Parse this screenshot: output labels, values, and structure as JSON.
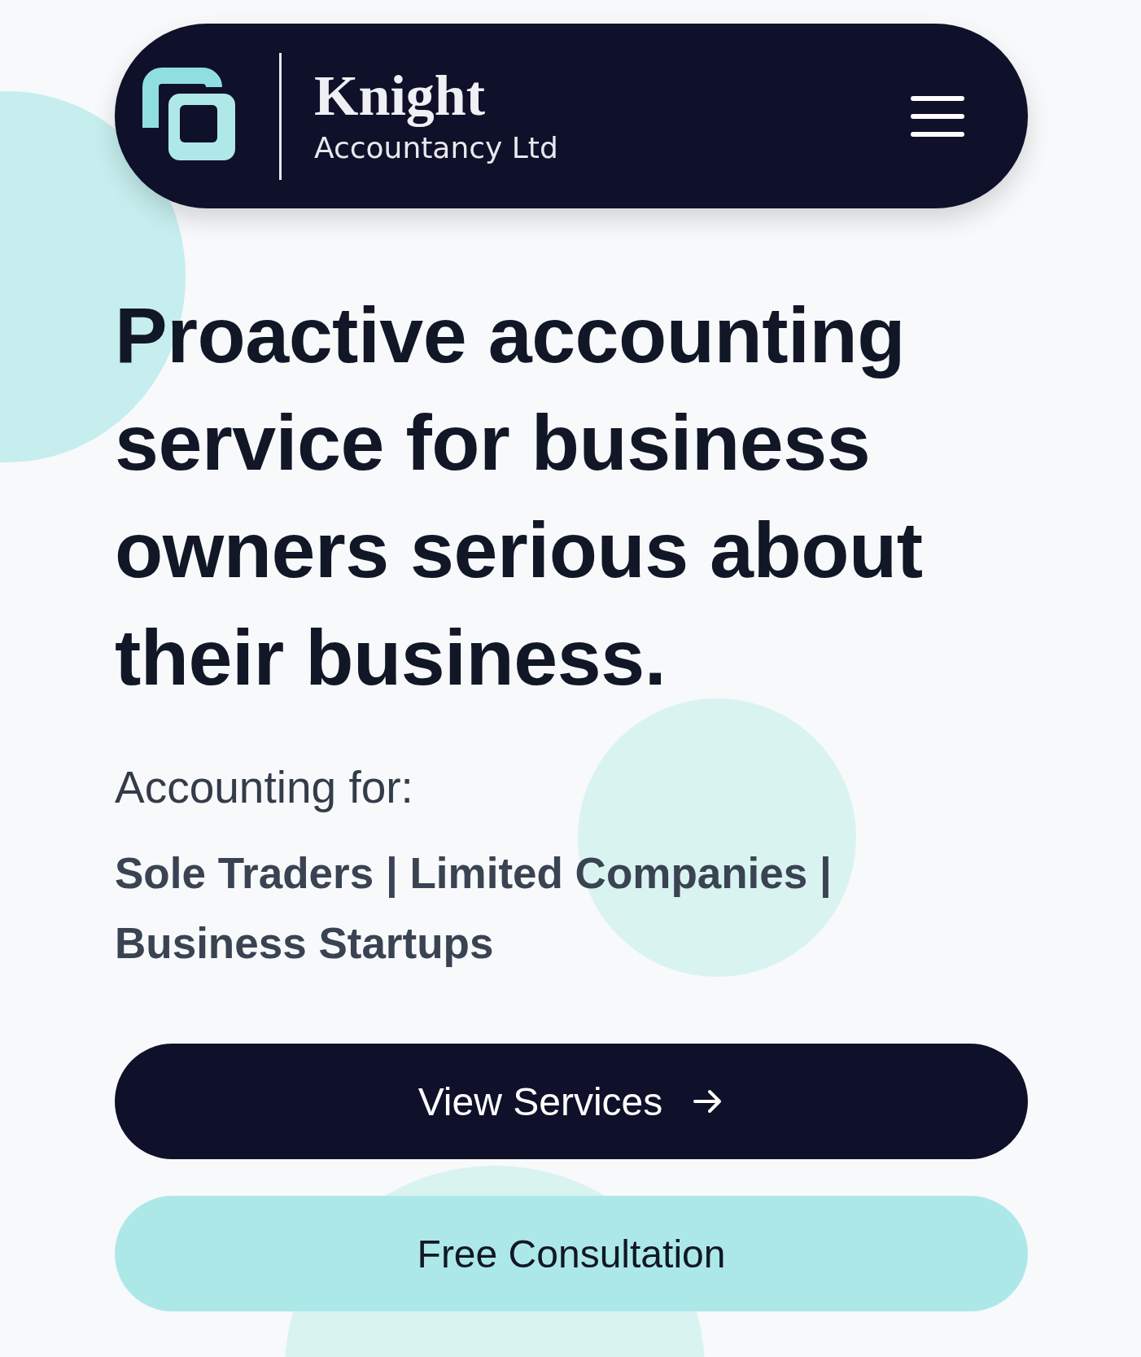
{
  "header": {
    "brand_name": "Knight",
    "brand_subtitle": "Accountancy Ltd"
  },
  "hero": {
    "headline": "Proactive accounting service for business owners serious about their business.",
    "intro": "Accounting for:",
    "audiences": "Sole Traders | Limited Companies | Business Startups"
  },
  "buttons": [
    {
      "label": "View Services",
      "kind": "primary"
    },
    {
      "label": "Free Consultation",
      "kind": "secondary"
    }
  ]
}
